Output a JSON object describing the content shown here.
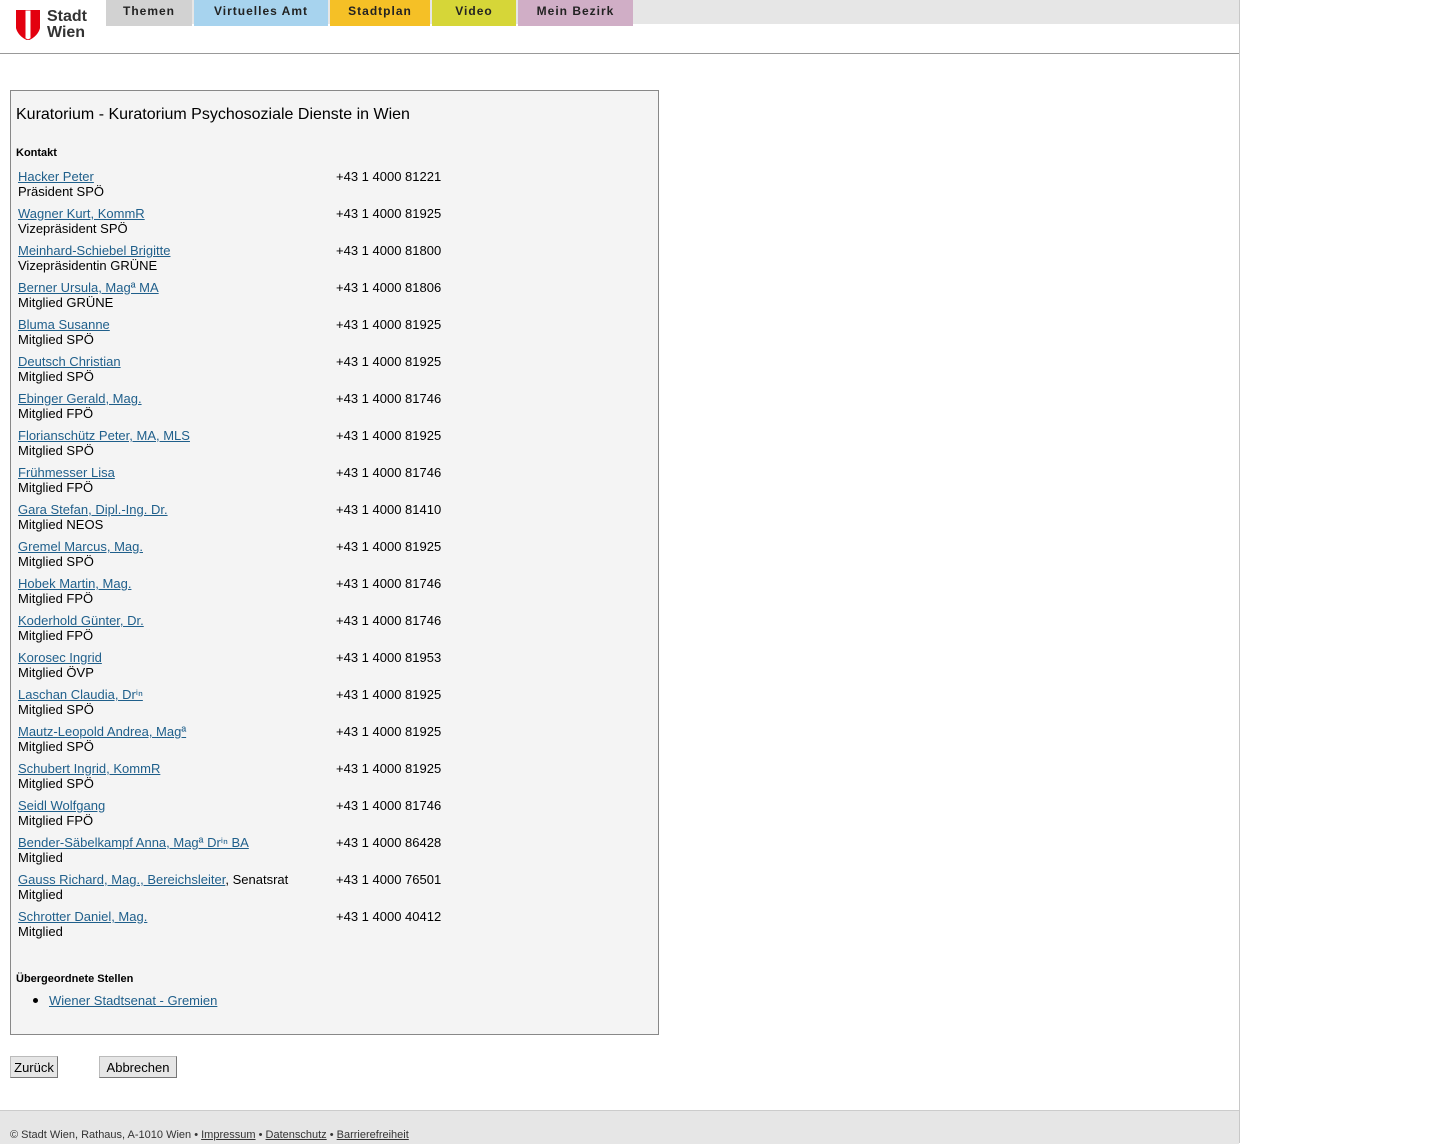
{
  "header": {
    "logo_line1": "Stadt",
    "logo_line2": "Wien",
    "tabs": [
      {
        "label": "Themen",
        "color": "#d2d2d2"
      },
      {
        "label": "Virtuelles Amt",
        "color": "#a7d3ee"
      },
      {
        "label": "Stadtplan",
        "color": "#f5c026"
      },
      {
        "label": "Video",
        "color": "#d6d638"
      },
      {
        "label": "Mein Bezirk",
        "color": "#d0aec6"
      }
    ]
  },
  "main": {
    "title": "Kuratorium - Kuratorium Psychosoziale Dienste in Wien",
    "contact_heading": "Kontakt",
    "contacts": [
      {
        "name": "Hacker Peter",
        "role": "Präsident SPÖ",
        "phone": "+43 1 4000 81221"
      },
      {
        "name": "Wagner Kurt, KommR",
        "role": "Vizepräsident SPÖ",
        "phone": "+43 1 4000 81925"
      },
      {
        "name": "Meinhard-Schiebel Brigitte",
        "role": "Vizepräsidentin GRÜNE",
        "phone": "+43 1 4000 81800"
      },
      {
        "name": "Berner Ursula, Magª MA",
        "role": "Mitglied GRÜNE",
        "phone": "+43 1 4000 81806"
      },
      {
        "name": "Bluma Susanne",
        "role": "Mitglied SPÖ",
        "phone": "+43 1 4000 81925"
      },
      {
        "name": "Deutsch Christian",
        "role": "Mitglied SPÖ",
        "phone": "+43 1 4000 81925"
      },
      {
        "name": "Ebinger Gerald, Mag.",
        "role": "Mitglied FPÖ",
        "phone": "+43 1 4000 81746"
      },
      {
        "name": "Florianschütz Peter, MA, MLS",
        "role": "Mitglied SPÖ",
        "phone": "+43 1 4000 81925"
      },
      {
        "name": "Frühmesser Lisa",
        "role": "Mitglied FPÖ",
        "phone": "+43 1 4000 81746"
      },
      {
        "name": "Gara Stefan, Dipl.-Ing. Dr.",
        "role": "Mitglied NEOS",
        "phone": "+43 1 4000 81410"
      },
      {
        "name": "Gremel Marcus, Mag.",
        "role": "Mitglied SPÖ",
        "phone": "+43 1 4000 81925"
      },
      {
        "name": "Hobek Martin, Mag.",
        "role": "Mitglied FPÖ",
        "phone": "+43 1 4000 81746"
      },
      {
        "name": "Koderhold Günter, Dr.",
        "role": "Mitglied FPÖ",
        "phone": "+43 1 4000 81746"
      },
      {
        "name": "Korosec Ingrid",
        "role": "Mitglied ÖVP",
        "phone": "+43 1 4000 81953"
      },
      {
        "name": "Laschan Claudia, Drⁱⁿ",
        "role": "Mitglied SPÖ",
        "phone": "+43 1 4000 81925"
      },
      {
        "name": "Mautz-Leopold Andrea, Magª",
        "role": "Mitglied SPÖ",
        "phone": "+43 1 4000 81925"
      },
      {
        "name": "Schubert Ingrid, KommR",
        "role": "Mitglied SPÖ",
        "phone": "+43 1 4000 81925"
      },
      {
        "name": "Seidl Wolfgang",
        "role": "Mitglied FPÖ",
        "phone": "+43 1 4000 81746"
      },
      {
        "name": "Bender-Säbelkampf Anna, Magª Drⁱⁿ BA",
        "role": "Mitglied",
        "phone": "+43 1 4000 86428"
      },
      {
        "name": "Gauss Richard, Mag., Bereichsleiter",
        "name_suffix": ", Senatsrat",
        "role": "Mitglied",
        "phone": "+43 1 4000 76501"
      },
      {
        "name": "Schrotter Daniel, Mag.",
        "role": "Mitglied",
        "phone": "+43 1 4000 40412"
      }
    ],
    "parent_heading": "Übergeordnete Stellen",
    "parent_links": [
      "Wiener Stadtsenat - Gremien"
    ]
  },
  "actions": {
    "back_label": "Zurück",
    "cancel_label": "Abbrechen"
  },
  "footer": {
    "copyright": "© Stadt Wien, Rathaus, A-1010 Wien",
    "separator": "•",
    "links": [
      "Impressum",
      "Datenschutz",
      "Barrierefreiheit"
    ]
  }
}
